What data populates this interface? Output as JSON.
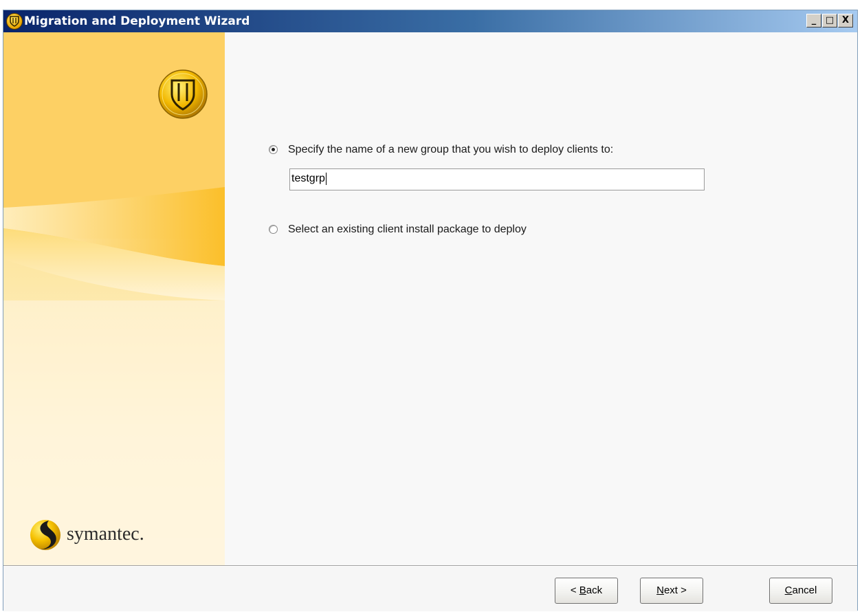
{
  "window": {
    "title": "Migration and Deployment Wizard",
    "controls": {
      "minimize": "_",
      "maximize": "□",
      "close": "X"
    }
  },
  "options": {
    "new_group": {
      "label": "Specify the name of a new group that you wish to deploy clients to:",
      "selected": true,
      "value": "testgrp"
    },
    "existing_package": {
      "label": "Select an existing client install package to deploy",
      "selected": false
    }
  },
  "branding": {
    "wordmark": "symantec."
  },
  "buttons": {
    "back": {
      "pre": "< ",
      "accel": "B",
      "post": "ack"
    },
    "next": {
      "pre": "",
      "accel": "N",
      "post": "ext >"
    },
    "cancel": {
      "pre": "",
      "accel": "C",
      "post": "ancel"
    }
  },
  "colors": {
    "title_start": "#0a246a",
    "title_end": "#a6caf0",
    "panel_accent": "#fdc02f"
  },
  "icons": [
    "shield-icon",
    "symantec-logo-icon",
    "minimize-icon",
    "maximize-icon",
    "close-icon"
  ]
}
